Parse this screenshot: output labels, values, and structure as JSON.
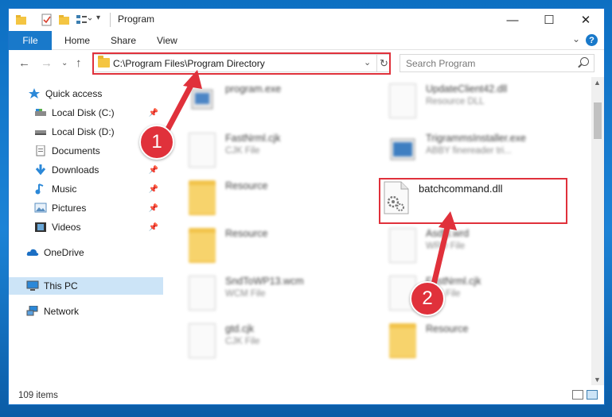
{
  "window": {
    "title": "Program",
    "controls": {
      "minimize": "—",
      "maximize": "☐",
      "close": "✕"
    }
  },
  "ribbon": {
    "tabs": [
      "File",
      "Home",
      "Share",
      "View"
    ],
    "help": "?"
  },
  "address": {
    "path": "C:\\Program Files\\Program Directory",
    "search_placeholder": "Search Program"
  },
  "sidebar": {
    "items": [
      {
        "label": "Quick access",
        "icon": "star-icon",
        "pinned": false
      },
      {
        "label": "Local Disk (C:)",
        "icon": "drive-icon",
        "pinned": true
      },
      {
        "label": "Local Disk (D:)",
        "icon": "drive-icon",
        "pinned": true
      },
      {
        "label": "Documents",
        "icon": "documents-icon",
        "pinned": true
      },
      {
        "label": "Downloads",
        "icon": "download-icon",
        "pinned": true
      },
      {
        "label": "Music",
        "icon": "music-icon",
        "pinned": true
      },
      {
        "label": "Pictures",
        "icon": "pictures-icon",
        "pinned": true
      },
      {
        "label": "Videos",
        "icon": "videos-icon",
        "pinned": true
      },
      {
        "label": "OneDrive",
        "icon": "cloud-icon",
        "pinned": false
      },
      {
        "label": "This PC",
        "icon": "computer-icon",
        "pinned": false,
        "selected": true
      },
      {
        "label": "Network",
        "icon": "network-icon",
        "pinned": false
      }
    ]
  },
  "files": {
    "left": [
      {
        "name": "program.exe",
        "type": "",
        "icon": "exe"
      },
      {
        "name": "FastNrml.cjk",
        "type": "CJK File",
        "icon": "doc"
      },
      {
        "name": "Resource",
        "type": "",
        "icon": "folder"
      },
      {
        "name": "Resource",
        "type": "",
        "icon": "folder"
      },
      {
        "name": "SndToWP13.wcm",
        "type": "WCM File",
        "icon": "doc"
      },
      {
        "name": "gtd.cjk",
        "type": "CJK File",
        "icon": "doc"
      }
    ],
    "right": [
      {
        "name": "UpdateClient42.dll",
        "type": "Resource DLL",
        "icon": "dll"
      },
      {
        "name": "TrigrammsInstaller.exe",
        "type": "ABBY finereader tri...",
        "icon": "app"
      },
      {
        "name": "Asdfjl.wrd",
        "type": "WRD File",
        "icon": "doc"
      },
      {
        "name": "FastNrml.cjk",
        "type": "CJK File",
        "icon": "doc"
      },
      {
        "name": "Resource",
        "type": "",
        "icon": "folder"
      }
    ],
    "highlighted": {
      "name": "batchcommand.dll"
    }
  },
  "status": {
    "items": "109 items"
  },
  "callouts": [
    "1",
    "2"
  ],
  "colors": {
    "accent": "#1979ca",
    "callout": "#e0313b",
    "selection": "#cce4f7"
  }
}
